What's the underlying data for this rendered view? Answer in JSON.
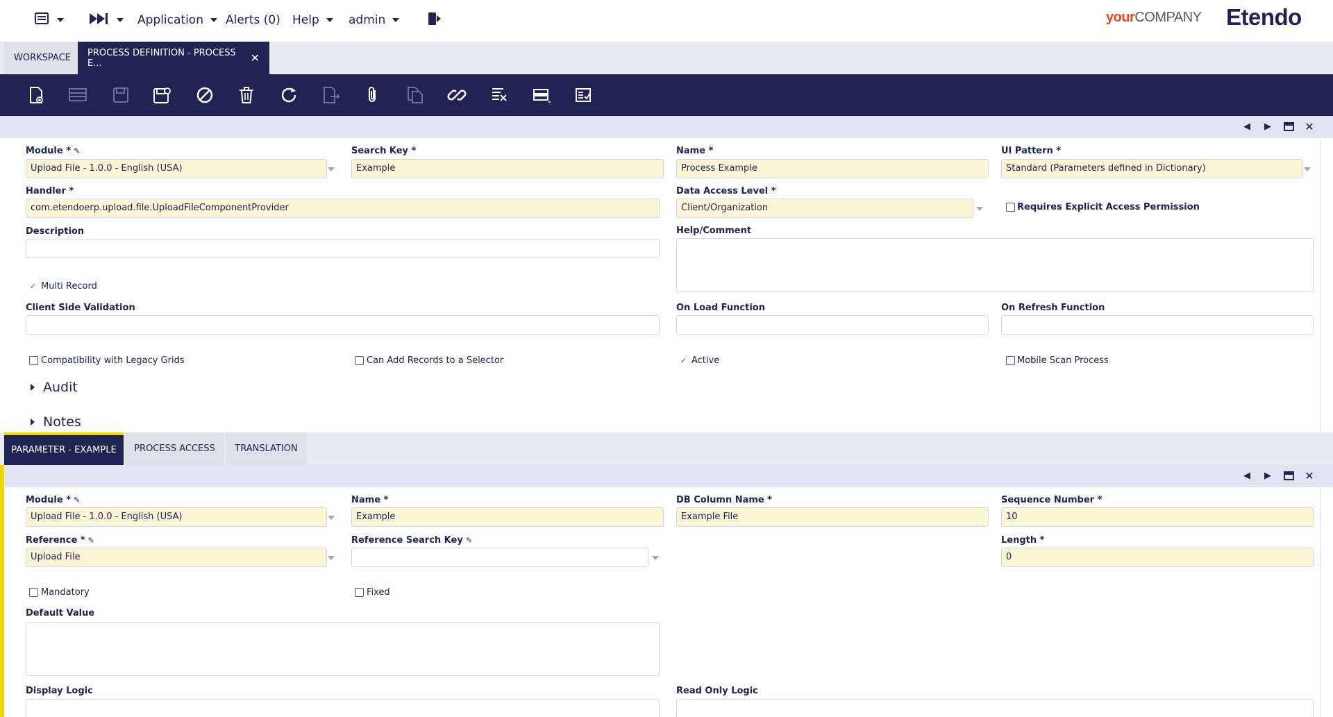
{
  "topbar": {
    "application_label": "Application",
    "alerts_label": "Alerts (0)",
    "help_label": "Help",
    "user_label": "admin",
    "brand_your": "your",
    "brand_company": "COMPANY",
    "brand_etendo": "Etendo"
  },
  "window_tabs": {
    "workspace": "WORKSPACE",
    "active": "PROCESS DEFINITION - PROCESS E..."
  },
  "colors": {
    "navy": "#202452",
    "required_field": "#fbf5d6",
    "accent_yellow": "#f4d400",
    "header_band": "#e2e4f3"
  },
  "header_form": {
    "module_label": "Module *",
    "module_value": "Upload File - 1.0.0 - English (USA)",
    "search_key_label": "Search Key *",
    "search_key_value": "Example",
    "name_label": "Name *",
    "name_value": "Process Example",
    "ui_pattern_label": "UI Pattern *",
    "ui_pattern_value": "Standard (Parameters defined in Dictionary)",
    "handler_label": "Handler *",
    "handler_value": "com.etendoerp.upload.file.UploadFileComponentProvider",
    "data_access_label": "Data Access Level *",
    "data_access_value": "Client/Organization",
    "requires_access_label": "Requires Explicit Access Permission",
    "description_label": "Description",
    "description_value": "",
    "help_comment_label": "Help/Comment",
    "help_comment_value": "",
    "multi_record_label": "Multi Record",
    "client_validation_label": "Client Side Validation",
    "on_load_label": "On Load Function",
    "on_refresh_label": "On Refresh Function",
    "legacy_grids_label": "Compatibility with Legacy Grids",
    "add_records_label": "Can Add Records to a Selector",
    "active_label": "Active",
    "mobile_scan_label": "Mobile Scan Process",
    "audit_label": "Audit",
    "notes_label": "Notes"
  },
  "sub_tabs": {
    "parameter": "PARAMETER - EXAMPLE",
    "process_access": "PROCESS ACCESS",
    "translation": "TRANSLATION"
  },
  "param_form": {
    "module_label": "Module *",
    "module_value": "Upload File - 1.0.0 - English (USA)",
    "name_label": "Name *",
    "name_value": "Example",
    "db_column_label": "DB Column Name *",
    "db_column_value": "Example File",
    "sequence_label": "Sequence Number *",
    "sequence_value": "10",
    "reference_label": "Reference *",
    "reference_value": "Upload File",
    "ref_search_key_label": "Reference Search Key",
    "ref_search_key_value": "",
    "length_label": "Length *",
    "length_value": "0",
    "mandatory_label": "Mandatory",
    "fixed_label": "Fixed",
    "default_value_label": "Default Value",
    "display_logic_label": "Display Logic",
    "read_only_logic_label": "Read Only Logic"
  },
  "icons": {
    "toolbar": [
      "new-document-icon",
      "new-row-icon",
      "save-icon",
      "save-close-icon",
      "undo-icon",
      "delete-icon",
      "refresh-icon",
      "export-icon",
      "attachment-icon",
      "copy-record-icon",
      "link-icon",
      "audit-trail-icon",
      "toggle-view-icon",
      "process-icon"
    ]
  }
}
